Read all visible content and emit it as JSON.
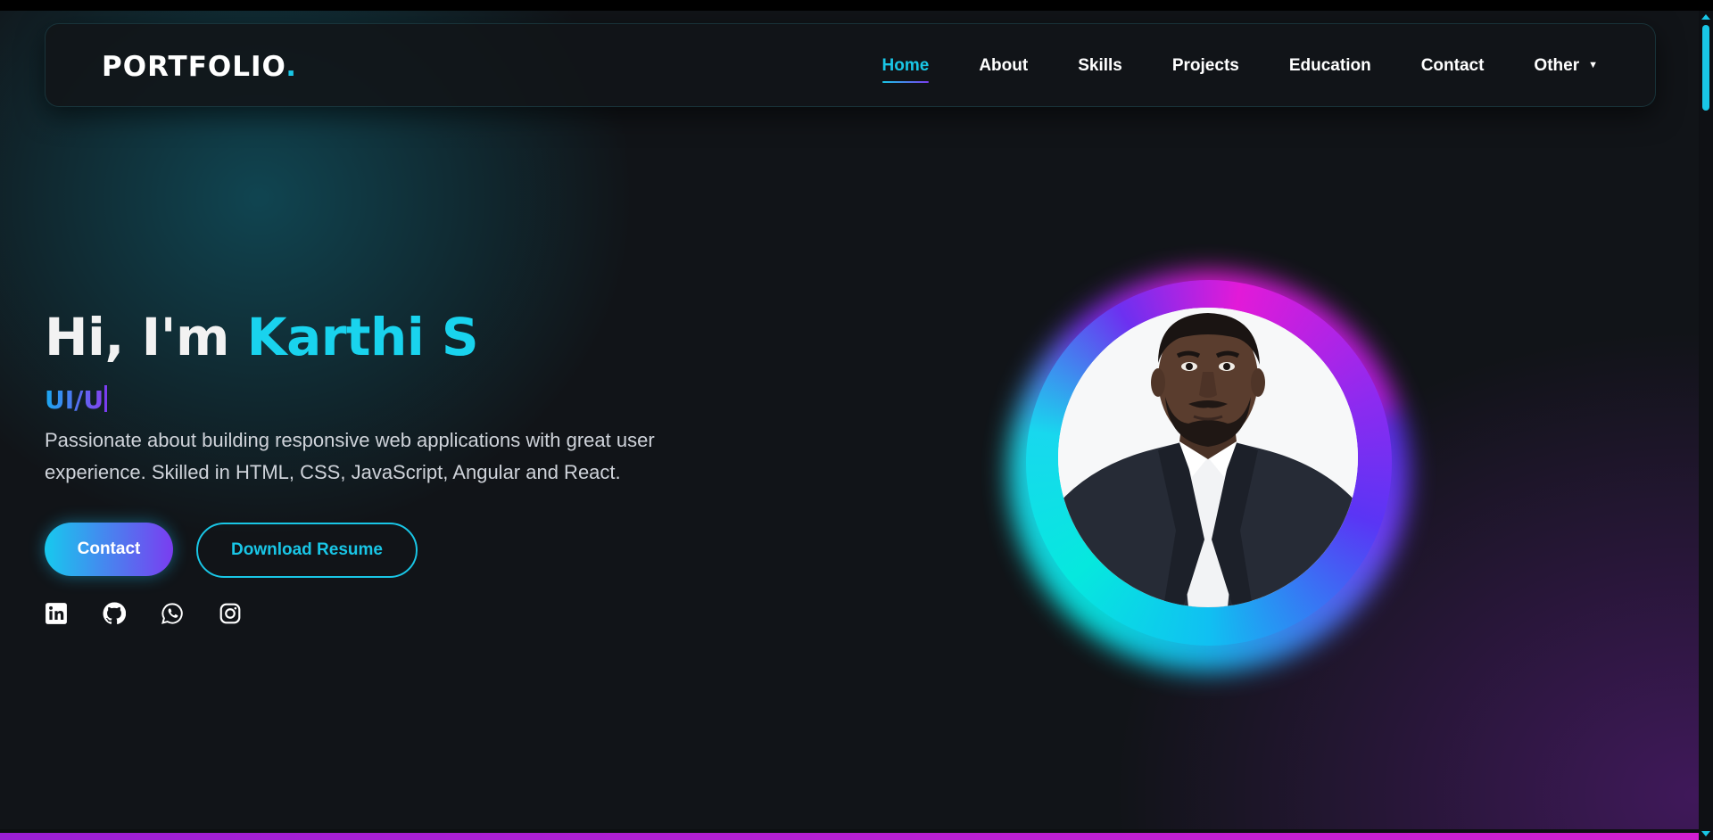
{
  "brand": {
    "logo_text": "PORTFOLIO",
    "logo_dot": "."
  },
  "nav": {
    "items": [
      {
        "label": "Home",
        "active": true
      },
      {
        "label": "About"
      },
      {
        "label": "Skills"
      },
      {
        "label": "Projects"
      },
      {
        "label": "Education"
      },
      {
        "label": "Contact"
      },
      {
        "label": "Other",
        "has_dropdown": true
      }
    ],
    "caret": "▼"
  },
  "hero": {
    "greeting": "Hi, I'm ",
    "name": "Karthi S",
    "role_typed": "UI/U",
    "description": "Passionate about building responsive web applications with great user experience. Skilled in HTML, CSS, JavaScript, Angular and React.",
    "contact_button": "Contact",
    "resume_button": "Download Resume"
  },
  "socials": [
    {
      "icon": "linkedin-icon"
    },
    {
      "icon": "github-icon"
    },
    {
      "icon": "whatsapp-icon"
    },
    {
      "icon": "instagram-icon"
    }
  ],
  "colors": {
    "accent_cyan": "#19c6e6",
    "accent_purple": "#7a3df0",
    "accent_magenta": "#e21ad8",
    "background": "#111418"
  }
}
